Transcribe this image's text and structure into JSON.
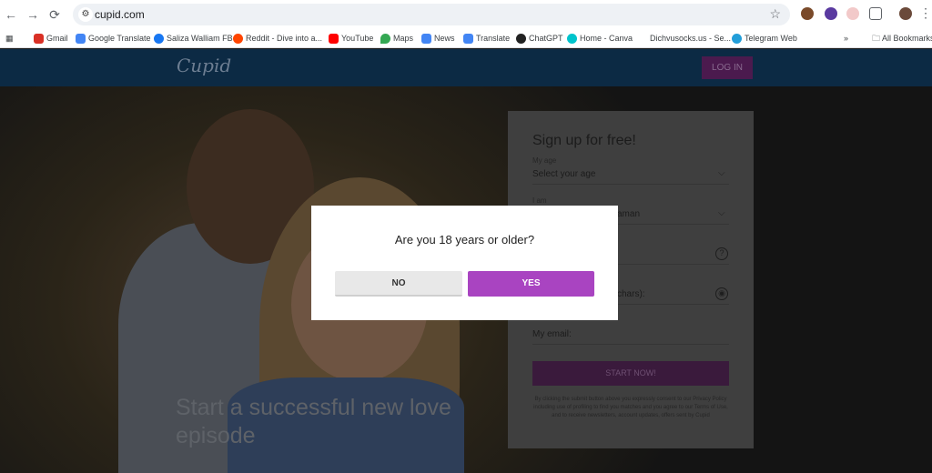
{
  "browser": {
    "url": "cupid.com",
    "bookmarks": [
      {
        "label": "Gmail",
        "color": "#d93025"
      },
      {
        "label": "Google Translate",
        "color": "#4285f4"
      },
      {
        "label": "Saliza Walliam FB",
        "color": "#1877f2"
      },
      {
        "label": "Reddit - Dive into a...",
        "color": "#ff4500"
      },
      {
        "label": "YouTube",
        "color": "#ff0000"
      },
      {
        "label": "Maps",
        "color": "#34a853"
      },
      {
        "label": "News",
        "color": "#4285f4"
      },
      {
        "label": "Translate",
        "color": "#4285f4"
      },
      {
        "label": "ChatGPT",
        "color": "#222222"
      },
      {
        "label": "Home - Canva",
        "color": "#00c4cc"
      },
      {
        "label": "Dichvusocks.us - Se...",
        "color": "#888888"
      },
      {
        "label": "Telegram Web",
        "color": "#229ed9"
      }
    ],
    "all_bookmarks": "All Bookmarks"
  },
  "site": {
    "logo": "Cupid",
    "login_label": "LOG IN",
    "hero_text": "Start a successful new love episode"
  },
  "signup": {
    "title": "Sign up for free!",
    "age_label": "My age",
    "age_value": "Select your age",
    "iam_label": "I am",
    "iam_value": "aman",
    "password_placeholder": "chars):",
    "email_placeholder": "My email:",
    "start_label": "START NOW!",
    "legal": "By clicking the submit button above you expressly consent to our Privacy Policy including use of profiling to find you matches and you agree to our Terms of Use, and to receive newsletters, account updates, offers sent by Cupid"
  },
  "modal": {
    "question": "Are you 18 years or older?",
    "no_label": "NO",
    "yes_label": "YES"
  },
  "colors": {
    "accent": "#a944c1",
    "header": "#0c2a44"
  }
}
